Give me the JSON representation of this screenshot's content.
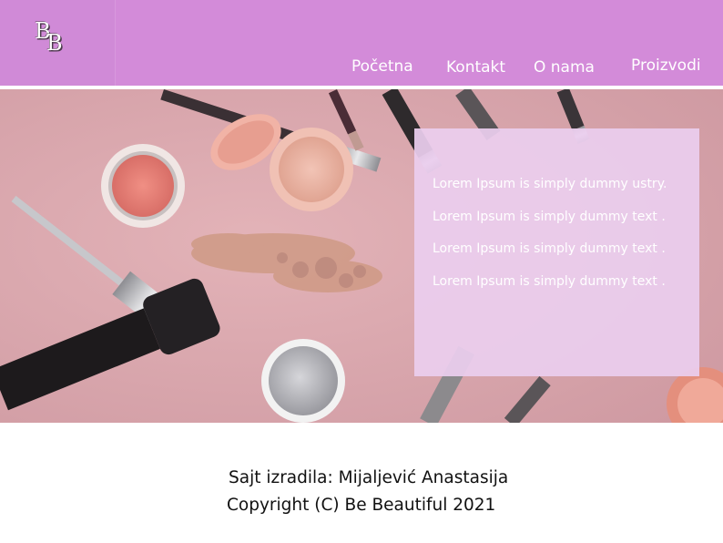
{
  "header": {
    "logo_text": "BB",
    "logo_letters": [
      "B",
      "B"
    ],
    "nav": [
      "Početna",
      "Kontakt",
      "O nama",
      "Proizvodi"
    ],
    "background_color": "#d38bd9"
  },
  "hero": {
    "image": "makeup-flatlay",
    "panel_lines": [
      "Lorem Ipsum is simply dummy ustry.",
      "Lorem Ipsum is simply dummy text .",
      "Lorem Ipsum is simply dummy text .",
      "Lorem Ipsum is simply dummy text ."
    ]
  },
  "footer": {
    "author_line": "Sajt izradila: Mijaljević Anastasija",
    "copyright_line": "Copyright (C) Be Beautiful 2021"
  }
}
